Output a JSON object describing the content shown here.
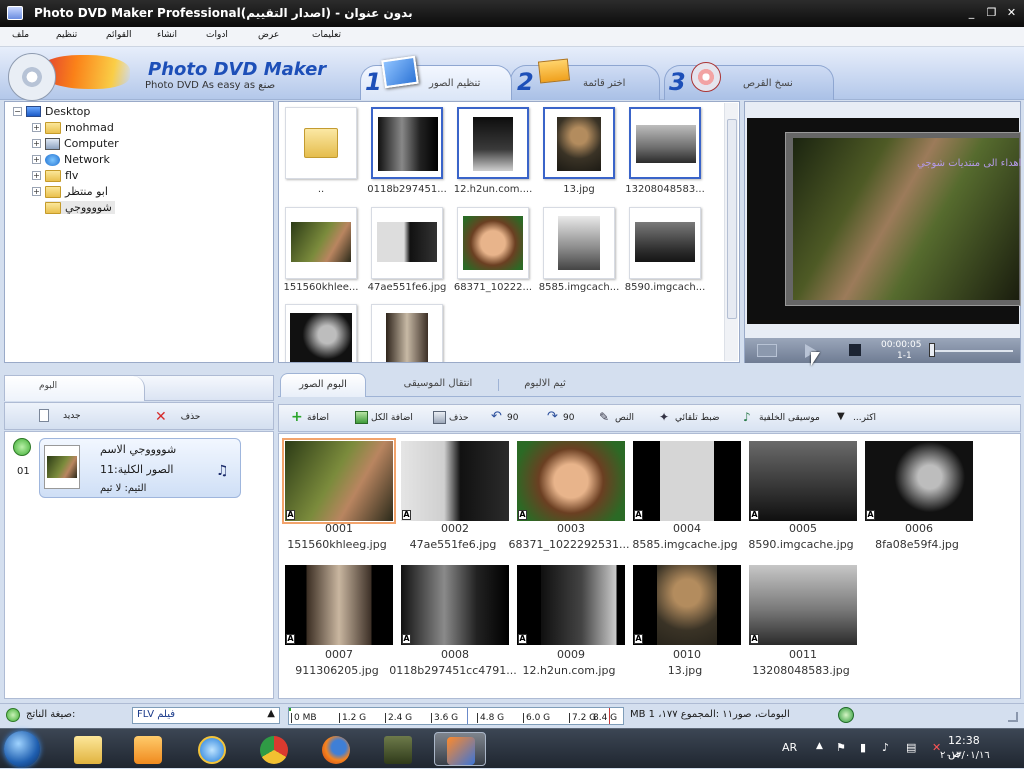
{
  "window": {
    "title": "Photo DVD Maker Professional(اصدار التقييم) - بدون عنوان",
    "minimize": "_",
    "restore": "❐",
    "close": "✕"
  },
  "menu": [
    "تعليمات",
    "عرض",
    "ادوات",
    "انشاء",
    "القوائم",
    "تنظيم",
    "ملف"
  ],
  "header": {
    "logo_title": "Photo DVD Maker",
    "logo_subtitle": "Photo DVD As easy as صنع",
    "steps": [
      {
        "num": "1",
        "label": "تنظيم الصور"
      },
      {
        "num": "2",
        "label": "اختر قائمة"
      },
      {
        "num": "3",
        "label": "نسخ القرص"
      }
    ]
  },
  "tree": {
    "root": "Desktop",
    "children": [
      "mohmad",
      "Computer",
      "Network",
      "flv",
      "ابو منتظر",
      "شووووجي"
    ]
  },
  "browser": {
    "items": [
      {
        "caption": "..",
        "type": "folder"
      },
      {
        "caption": "0118b297451...",
        "type": "photo",
        "selected": true
      },
      {
        "caption": "12.h2un.com....",
        "type": "photo",
        "selected": true
      },
      {
        "caption": "13.jpg",
        "type": "photo",
        "selected": true
      },
      {
        "caption": "13208048583...",
        "type": "photo",
        "selected": true
      },
      {
        "caption": "151560khlee...",
        "type": "photo"
      },
      {
        "caption": "47ae551fe6.jpg",
        "type": "photo"
      },
      {
        "caption": "68371_10222...",
        "type": "photo"
      },
      {
        "caption": "8585.imgcach...",
        "type": "photo"
      },
      {
        "caption": "8590.imgcach...",
        "type": "photo"
      },
      {
        "caption": "",
        "type": "photo"
      },
      {
        "caption": "",
        "type": "photo"
      }
    ]
  },
  "preview": {
    "overlay_text": "اهداء الى منتديات شوجي",
    "time": "00:00:05",
    "slide": "1-1"
  },
  "album_panel": {
    "header": "البوم",
    "delete_label": "حذف",
    "new_label": "جديد",
    "album": {
      "index": "01",
      "name": "شووووجي الاسم",
      "total": "الصور الكلية:11",
      "theme": "الثيم: لا ثيم"
    }
  },
  "lower_tabs": [
    "البوم الصور",
    "انتقال الموسيقى",
    "ثيم الالبوم"
  ],
  "toolbar": {
    "add": "اضافة",
    "add_all": "اضافة الكل",
    "delete": "حذف",
    "rotate_left": "90",
    "rotate_right": "90",
    "text": "النص",
    "auto_adjust": "ضبط تلقائي",
    "bg_music": "موسيقى الخلفية",
    "more": "...اكثر"
  },
  "storyboard": [
    {
      "num": "0001",
      "name": "151560khleeg.jpg"
    },
    {
      "num": "0002",
      "name": "47ae551fe6.jpg"
    },
    {
      "num": "0003",
      "name": "68371_1022292531..."
    },
    {
      "num": "0004",
      "name": "8585.imgcache.jpg"
    },
    {
      "num": "0005",
      "name": "8590.imgcache.jpg"
    },
    {
      "num": "0006",
      "name": "8fa08e59f4.jpg"
    },
    {
      "num": "0007",
      "name": "911306205.jpg"
    },
    {
      "num": "0008",
      "name": "0118b297451cc4791..."
    },
    {
      "num": "0009",
      "name": "12.h2un.com.jpg"
    },
    {
      "num": "0010",
      "name": "13.jpg"
    },
    {
      "num": "0011",
      "name": "13208048583.jpg"
    }
  ],
  "status": {
    "output_format_label": "صيغة الناتج:",
    "format_value": "FLV فيلم",
    "capacity_ticks": [
      "0 MB",
      "1.2 G",
      "2.4 G",
      "3.6 G",
      "4.8 G",
      "6.0 G",
      "7.2 G",
      "8.4 G"
    ],
    "summary": "MB البومات، صور١١ :المجموع ١٧٧، 1"
  },
  "taskbar": {
    "lang": "AR",
    "time": "12:38 ص",
    "date": "٢٠١٣/٠١/١٦"
  },
  "colors": {
    "accent": "#1d4fb8",
    "selection": "#3a64c9",
    "highlight": "#f2a36b"
  }
}
